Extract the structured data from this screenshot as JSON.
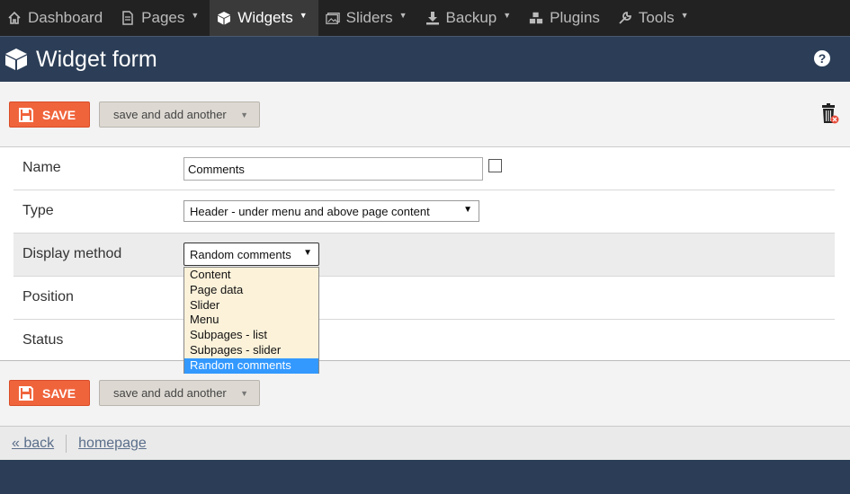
{
  "nav": {
    "items": [
      {
        "label": "Dashboard",
        "icon": "home-icon",
        "caret": false
      },
      {
        "label": "Pages",
        "icon": "document-icon",
        "caret": true
      },
      {
        "label": "Widgets",
        "icon": "cube-icon",
        "caret": true,
        "active": true
      },
      {
        "label": "Sliders",
        "icon": "image-icon",
        "caret": true
      },
      {
        "label": "Backup",
        "icon": "download-icon",
        "caret": true
      },
      {
        "label": "Plugins",
        "icon": "cubes-icon",
        "caret": false
      },
      {
        "label": "Tools",
        "icon": "wrench-icon",
        "caret": true
      }
    ]
  },
  "header": {
    "title": "Widget form",
    "help": "?"
  },
  "toolbar": {
    "save_label": "SAVE",
    "another_label": "save and add another"
  },
  "form": {
    "name": {
      "label": "Name",
      "value": "Comments"
    },
    "type": {
      "label": "Type",
      "value": "Header - under menu and above page content"
    },
    "display_method": {
      "label": "Display method",
      "value": "Random comments",
      "options": [
        "Content",
        "Page data",
        "Slider",
        "Menu",
        "Subpages - list",
        "Subpages - slider",
        "Random comments"
      ]
    },
    "position": {
      "label": "Position"
    },
    "status": {
      "label": "Status"
    }
  },
  "footer": {
    "back_label": "« back",
    "homepage_label": "homepage"
  },
  "colors": {
    "accent": "#f0643c",
    "header": "#2c3e57",
    "nav": "#222222",
    "selected": "#3399ff"
  }
}
